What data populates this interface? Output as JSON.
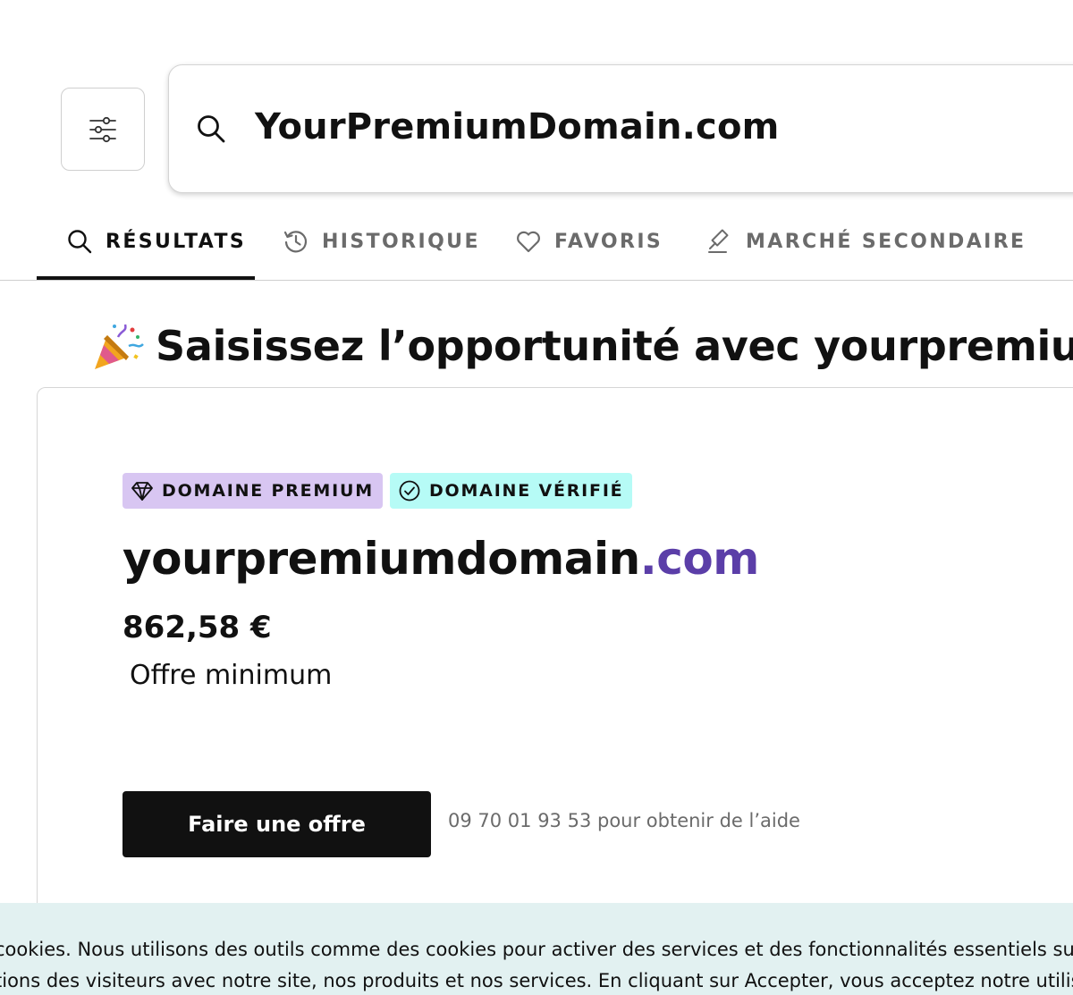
{
  "search": {
    "value": "YourPremiumDomain.com"
  },
  "tabs": [
    {
      "label": "RÉSULTATS",
      "active": true,
      "icon": "search-icon"
    },
    {
      "label": "HISTORIQUE",
      "active": false,
      "icon": "history-icon"
    },
    {
      "label": "FAVORIS",
      "active": false,
      "icon": "heart-icon"
    },
    {
      "label": "MARCHÉ SECONDAIRE",
      "active": false,
      "icon": "gavel-icon"
    }
  ],
  "headline": {
    "text": "Saisissez l’opportunité avec yourpremiumdomain.com",
    "emoji": "party-popper-icon"
  },
  "result": {
    "badges": [
      {
        "label": "DOMAINE PREMIUM",
        "icon": "diamond-icon",
        "color": "#d8c6f2"
      },
      {
        "label": "DOMAINE VÉRIFIÉ",
        "icon": "check-circle-icon",
        "color": "#b6fbf6"
      }
    ],
    "domain_name": "yourpremiumdomain",
    "domain_tld": ".com",
    "price": "862,58 €",
    "price_label": "Offre minimum",
    "offer_button": "Faire une offre",
    "help_text": "09 70 01 93 53 pour obtenir de l’aide"
  },
  "cookie_banner": {
    "line1": "cookies. Nous utilisons des outils comme des cookies pour activer des services et des fonctionnalités essentiels sur n",
    "line2": "tions des visiteurs avec notre site, nos produits et nos services. En cliquant sur Accepter, vous acceptez notre utilisa"
  },
  "colors": {
    "accent_tld": "#5b3ea8",
    "button_bg": "#111111",
    "cookie_bg": "#e2f1f1"
  }
}
